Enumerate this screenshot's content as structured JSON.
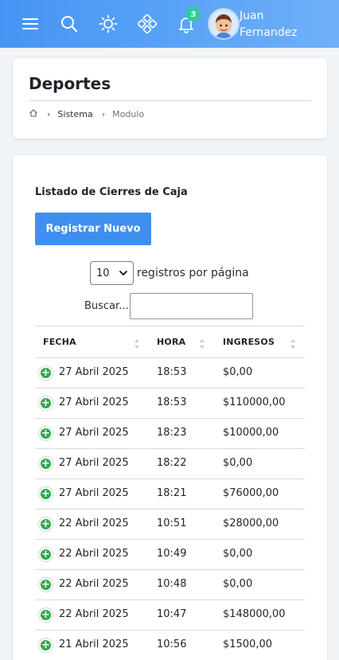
{
  "header": {
    "notifications_count": "3",
    "user_first": "Juan",
    "user_last": "Fernandez",
    "icons": [
      "menu-icon",
      "search-icon",
      "sun-icon",
      "apps-icon",
      "bell-icon",
      "avatar"
    ]
  },
  "page": {
    "title": "Deportes",
    "breadcrumb": [
      "Sistema",
      "Modulo"
    ]
  },
  "list": {
    "title": "Listado de Cierres de Caja",
    "new_button": "Registrar Nuevo",
    "page_size": "10",
    "page_size_label": "registros por página",
    "search_label": "Buscar..."
  },
  "table": {
    "columns": [
      "FECHA",
      "HORA",
      "INGRESOS"
    ],
    "rows": [
      {
        "fecha": "27 Abril 2025",
        "hora": "18:53",
        "ingresos": "$0,00"
      },
      {
        "fecha": "27 Abril 2025",
        "hora": "18:53",
        "ingresos": "$110000,00"
      },
      {
        "fecha": "27 Abril 2025",
        "hora": "18:23",
        "ingresos": "$10000,00"
      },
      {
        "fecha": "27 Abril 2025",
        "hora": "18:22",
        "ingresos": "$0,00"
      },
      {
        "fecha": "27 Abril 2025",
        "hora": "18:21",
        "ingresos": "$76000,00"
      },
      {
        "fecha": "22 Abril 2025",
        "hora": "10:51",
        "ingresos": "$28000,00"
      },
      {
        "fecha": "22 Abril 2025",
        "hora": "10:49",
        "ingresos": "$0,00"
      },
      {
        "fecha": "22 Abril 2025",
        "hora": "10:48",
        "ingresos": "$0,00"
      },
      {
        "fecha": "22 Abril 2025",
        "hora": "10:47",
        "ingresos": "$148000,00"
      },
      {
        "fecha": "21 Abril 2025",
        "hora": "10:56",
        "ingresos": "$1500,00"
      }
    ]
  },
  "colors": {
    "topbar": "#4695f4",
    "primary_button": "#3f8ff0",
    "expand_icon": "#2fa84f",
    "badge": "#2ecc9a"
  }
}
